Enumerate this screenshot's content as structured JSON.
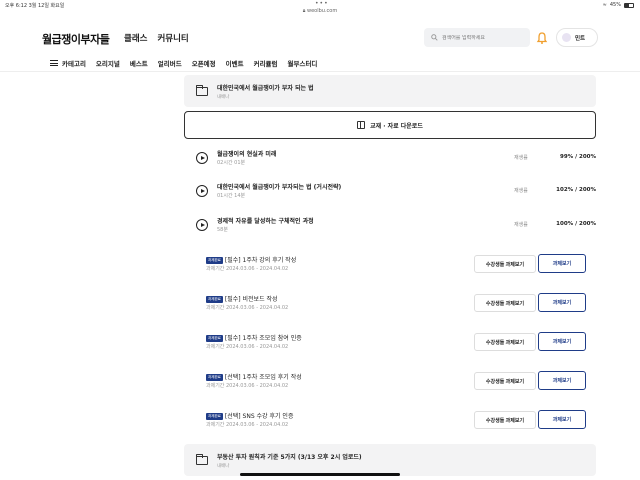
{
  "status_bar": {
    "time": "오후 6:12  3월 12일 화요일",
    "wifi": "≈",
    "battery": "45%"
  },
  "url": "weolbu.com",
  "header": {
    "logo": "월급쟁이부자들",
    "nav": [
      "클래스",
      "커뮤니티"
    ],
    "search_placeholder": "검색어를 입력하세요",
    "user_name": "민트"
  },
  "category_nav": {
    "menu_label": "카테고리",
    "items": [
      "오리지널",
      "베스트",
      "얼리버드",
      "오픈예정",
      "이벤트",
      "커리큘럼",
      "월부스터디"
    ]
  },
  "sections": [
    {
      "title": "대한민국에서 월급쟁이가 부자 되는 법",
      "sub": "내배나"
    },
    {
      "title": "부동산 투자 원칙과 기준 5가지 (3/13 오후 2시 업로드)",
      "sub": "내배나"
    }
  ],
  "download_label": "교재 · 자료 다운로드",
  "lessons": [
    {
      "title": "월급쟁이의 현실과 미래",
      "duration": "02시간 01분",
      "status": "재생률",
      "progress": "99% / 200%"
    },
    {
      "title": "대한민국에서 월급쟁이가 부자되는 법 (거시전략)",
      "duration": "01시간 14분",
      "status": "재생률",
      "progress": "102% / 200%"
    },
    {
      "title": "경제적 자유를 달성하는 구체적인 과정",
      "duration": "58분",
      "status": "재생률",
      "progress": "100% / 200%"
    }
  ],
  "assignments": [
    {
      "badge": "과제완료",
      "title": "[필수] 1주차 강의 후기 작성",
      "period": "과제기간 2024.03.06 - 2024.04.02",
      "view_label": "수강생들 과제보기",
      "task_label": "과제보기"
    },
    {
      "badge": "과제완료",
      "title": "[필수] 비전보드 작성",
      "period": "과제기간 2024.03.06 - 2024.04.02",
      "view_label": "수강생들 과제보기",
      "task_label": "과제보기"
    },
    {
      "badge": "과제완료",
      "title": "[필수] 1주차 조모임 참여 인증",
      "period": "과제기간 2024.03.06 - 2024.04.02",
      "view_label": "수강생들 과제보기",
      "task_label": "과제보기"
    },
    {
      "badge": "과제완료",
      "title": "[선택] 1주차 조모임 후기 작성",
      "period": "과제기간 2024.03.06 - 2024.04.02",
      "view_label": "수강생들 과제보기",
      "task_label": "과제보기"
    },
    {
      "badge": "과제완료",
      "title": "[선택] SNS 수강 후기 인증",
      "period": "과제기간 2024.03.06 - 2024.04.02",
      "view_label": "수강생들 과제보기",
      "task_label": "과제보기"
    }
  ],
  "colors": {
    "accent": "#1f3c88",
    "bell": "#f0a030",
    "section_bg": "#f3f3f4"
  }
}
